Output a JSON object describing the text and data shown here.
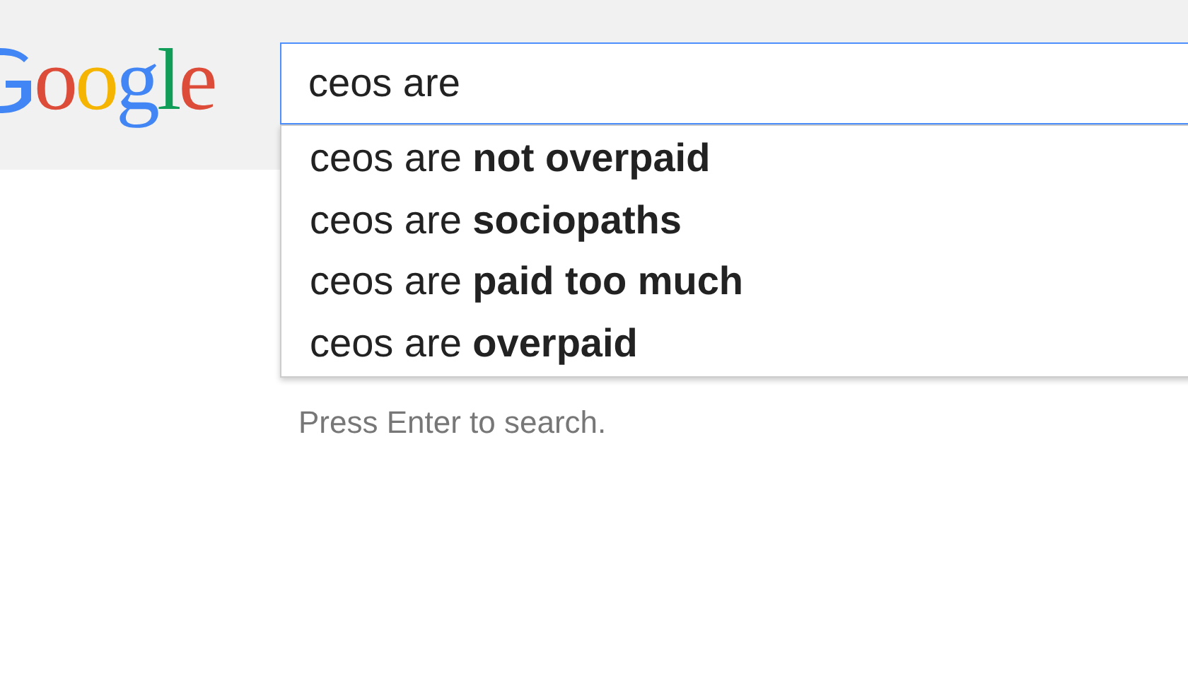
{
  "logo": {
    "letters": [
      {
        "char": "o",
        "color": "#dd4b39"
      },
      {
        "char": "o",
        "color": "#f4b400"
      },
      {
        "char": "g",
        "color": "#4285f4"
      },
      {
        "char": "l",
        "color": "#0f9d58"
      },
      {
        "char": "e",
        "color": "#dd4b39"
      }
    ]
  },
  "search": {
    "value": "ceos are"
  },
  "suggestions": [
    {
      "text": "ceos are **not overpaid**",
      "selected": false
    },
    {
      "text": "ceos are **sociopaths**",
      "selected": false
    },
    {
      "text": "ceos are **paid too much**",
      "selected": false
    },
    {
      "text": "ceos are **overpaid**",
      "selected": false
    }
  ],
  "hint": "Press Enter to search."
}
